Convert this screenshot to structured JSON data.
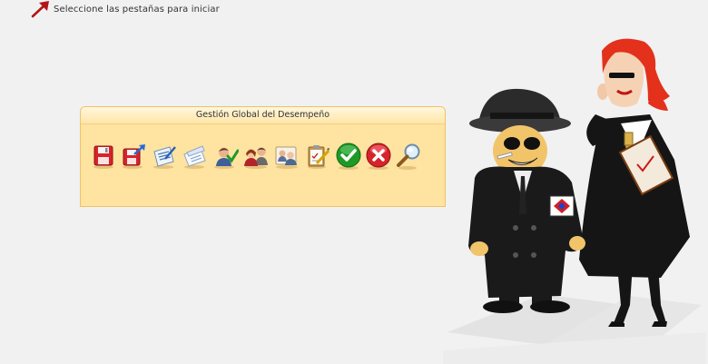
{
  "hint": {
    "text": "Seleccione las pestañas para iniciar",
    "arrow_icon": "arrow-up-right-icon"
  },
  "panel": {
    "title": "Gestión Global del Desempeño",
    "tools": [
      {
        "icon": "save-disk-icon"
      },
      {
        "icon": "save-export-icon"
      },
      {
        "icon": "edit-document-icon"
      },
      {
        "icon": "document-list-icon"
      },
      {
        "icon": "user-approve-icon"
      },
      {
        "icon": "users-group-icon"
      },
      {
        "icon": "users-card-icon"
      },
      {
        "icon": "clipboard-edit-icon"
      },
      {
        "icon": "accept-check-icon"
      },
      {
        "icon": "cancel-x-icon"
      },
      {
        "icon": "search-magnifier-icon"
      }
    ]
  },
  "illustration": {
    "icon": "detective-characters-illustration"
  },
  "colors": {
    "background": "#f1f1f1",
    "panel_fill": "#ffe3a0",
    "panel_border": "#f0c366",
    "arrow": "#b0151a"
  }
}
